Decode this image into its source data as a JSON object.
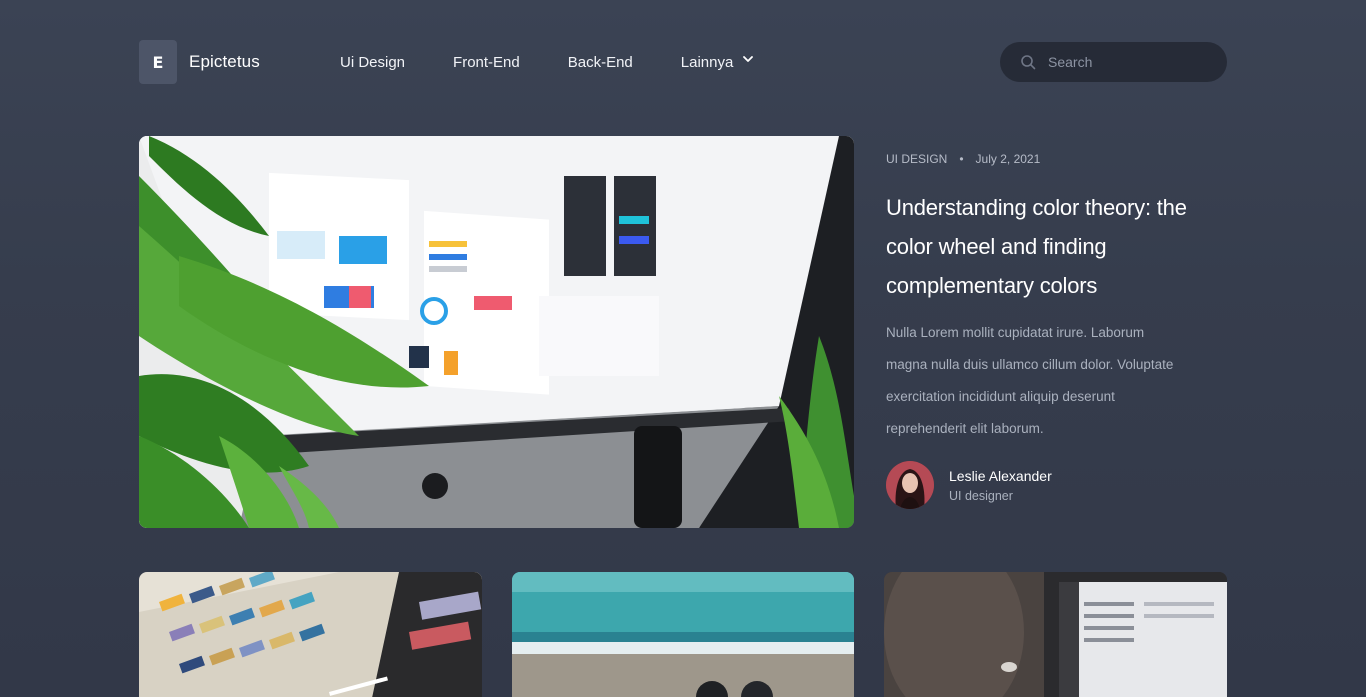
{
  "nav": {
    "brand_letter": "E",
    "brand_name": "Epictetus",
    "menu": [
      "Ui Design",
      "Front-End",
      "Back-End",
      "Lainnya"
    ],
    "search_placeholder": "Search"
  },
  "featured": {
    "category": "UI DESIGN",
    "separator": "•",
    "date": "July 2, 2021",
    "title": "Understanding color theory: the color wheel and finding complementary colors",
    "excerpt": "Nulla Lorem mollit cupidatat irure. Laborum magna nulla duis ullamco cillum dolor. Voluptate exercitation incididunt aliquip deserunt reprehenderit elit laborum.",
    "author": {
      "name": "Leslie Alexander",
      "role": "UI designer"
    }
  },
  "colors": {
    "background": "#3b4354",
    "search_bg": "#262b37",
    "brand_mark_bg": "#4d5568",
    "muted_text": "#aab1be"
  }
}
